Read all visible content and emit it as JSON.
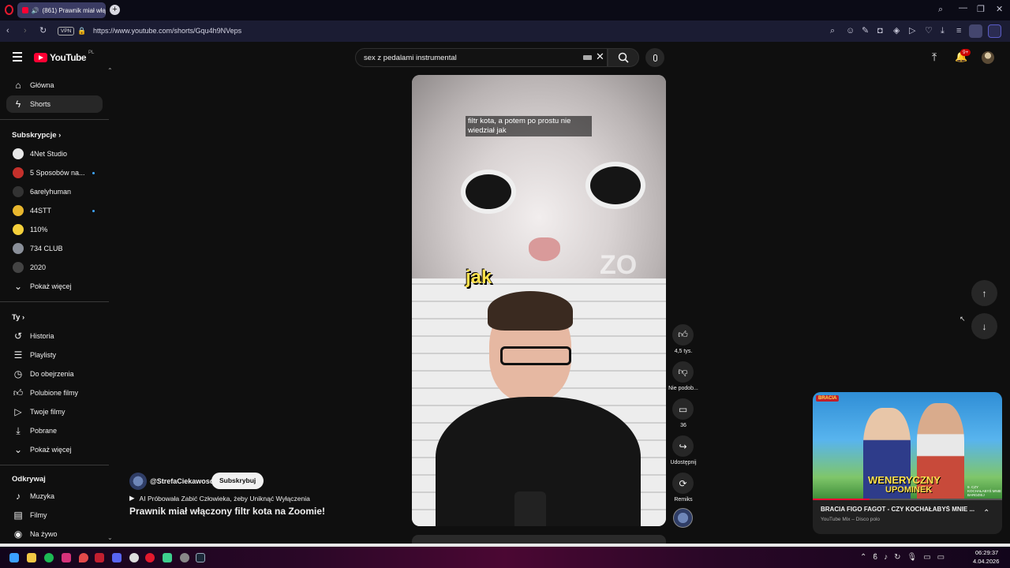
{
  "browser": {
    "tab_title": "(861) Prawnik miał włą",
    "url": "https://www.youtube.com/shorts/Gqu4h9NVeps",
    "vpn_label": "VPN"
  },
  "youtube": {
    "logo_text": "YouTube",
    "logo_region": "PL",
    "search_value": "sex z pedalami instrumental",
    "notif_badge": "9+"
  },
  "sidebar": {
    "main": [
      {
        "label": "Główna",
        "icon": "home-icon"
      },
      {
        "label": "Shorts",
        "icon": "shorts-icon"
      }
    ],
    "subs_header": "Subskrypcje",
    "subs": [
      {
        "label": "4Net Studio",
        "color": "#e8e8e8",
        "dot": false
      },
      {
        "label": "5 Sposobów na...",
        "color": "#c4302b",
        "dot": true
      },
      {
        "label": "6arelyhuman",
        "color": "#333333",
        "dot": false
      },
      {
        "label": "44STT",
        "color": "#e8b72e",
        "dot": true
      },
      {
        "label": "110%",
        "color": "#f5d03b",
        "dot": false
      },
      {
        "label": "734 CLUB",
        "color": "#8a8f99",
        "dot": false
      },
      {
        "label": "2020",
        "color": "#444444",
        "dot": false
      }
    ],
    "show_more_1": "Pokaż więcej",
    "you_header": "Ty",
    "you": [
      {
        "label": "Historia",
        "icon": "history-icon"
      },
      {
        "label": "Playlisty",
        "icon": "playlist-icon"
      },
      {
        "label": "Do obejrzenia",
        "icon": "watch-later-icon"
      },
      {
        "label": "Polubione filmy",
        "icon": "like-icon"
      },
      {
        "label": "Twoje filmy",
        "icon": "your-videos-icon"
      },
      {
        "label": "Pobrane",
        "icon": "download-icon"
      }
    ],
    "show_more_2": "Pokaż więcej",
    "explore_header": "Odkrywaj",
    "explore": [
      {
        "label": "Muzyka",
        "icon": "music-icon"
      },
      {
        "label": "Filmy",
        "icon": "movies-icon"
      },
      {
        "label": "Na żywo",
        "icon": "live-icon"
      }
    ]
  },
  "short": {
    "caption_top": "filtr kota, a potem po prostu nie wiedział jak",
    "caption_big": "jak",
    "watermark": "ZO",
    "channel": "@StrefaCiekawosci",
    "subscribe": "Subskrybuj",
    "playlist_line": "AI Próbowała Zabić Człowieka, żeby Uniknąć Wyłączenia",
    "title": "Prawnik miał włączony filtr kota na Zoomie!"
  },
  "actions": {
    "likes": "4,5 tys.",
    "dislike": "Nie podob...",
    "comments": "36",
    "share": "Udostępnij",
    "remix": "Remiks"
  },
  "miniplayer": {
    "title": "BRACIA FIGO FAGOT - CZY KOCHAŁABYŚ MNIE ...",
    "subtitle": "YouTube Mix – Disco polo",
    "thumb_title_1": "WENERYCZNY",
    "thumb_title_2": "UPOMINEK",
    "thumb_badge": "BRACIA",
    "thumb_side": "9. CZY KOCHAŁABYŚ MNIE BARDZIEJ"
  },
  "taskbar": {
    "time": "06:29:37",
    "date": "4.04.2026"
  }
}
